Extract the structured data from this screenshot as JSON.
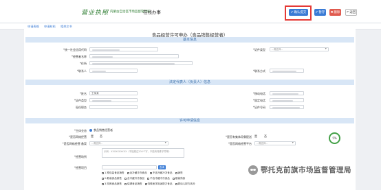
{
  "header": {
    "logo_calligraphy": "营业执照",
    "logo_sub": "内蒙古自治区市场监督管理局",
    "title": "在线办事",
    "buttons": {
      "confirm": "确认提交",
      "save": "暂存",
      "delete": "删除",
      "back": "返回"
    }
  },
  "tabs": [
    "申请表格",
    "申请材料",
    "相关文书"
  ],
  "form": {
    "title": "食品经营许可申办（食品销售经营者）",
    "sections": {
      "basic": "基本信息",
      "legal": "法定代表人（负责人）信息",
      "license": "许可申请信息"
    },
    "basic": {
      "credit_code_label": "*统一社会信用代码",
      "credit_code_value": "",
      "operator_name_label": "*经营者名称",
      "operator_name_value": "",
      "residence_label": "*住所",
      "residence_value": "",
      "certificate_label": "*证件类型",
      "certificate_value": "--请选择--",
      "contact_label": "*联系人",
      "contact_value": "",
      "contact_phone_label": "*联系方式",
      "contact_phone_value": ""
    },
    "legal": {
      "name_label": "*姓名",
      "name_value": "王某某",
      "id_type_label": "*证件类型",
      "id_type_value": "",
      "position_label": "现任职务",
      "position_value": "",
      "phone_label": "*移动电话",
      "phone_value": "",
      "mobile_label": "*固定电话",
      "mobile_value": "",
      "id_no_label": "*证件号码",
      "id_no_value": ""
    },
    "license": {
      "entity_label": "*主体业态",
      "entity_option": "食品销售经营者",
      "chain_label": "*是否网络经营",
      "chain_options": [
        "是",
        "否"
      ],
      "mgmt_label": "*是否有集体用餐配送",
      "mgmt_options": [
        "是",
        "否"
      ],
      "store_label": "*是否网络经营 备案",
      "store_value": "--请选择--",
      "other_label": "*是否网络经营平台",
      "other_value": "--请选择--",
      "scope_label": "*经营项目",
      "scope_placeholder": "示例：XXXXXXXXXX（不能超过200个字，不能有特殊字符等）",
      "remark_label": "*经营场所",
      "project_label": "*经营项目",
      "query_label": "查询",
      "checkbox_rows": [
        [
          "1.预包装食品销售",
          "含冷藏冷冻食品",
          "不含冷藏冷冻食品",
          "销售"
        ],
        [
          "2.散装食品销售",
          "含冷藏冷冻食品",
          "不含冷藏冷冻食品",
          "散装熟食"
        ],
        [
          "3.特殊食品销售",
          "保健食品销售",
          "特殊医学用途配方食品",
          "婴幼儿配方乳粉",
          "其他婴幼儿配方食品"
        ]
      ]
    }
  },
  "gauge_text": "5%",
  "watermark": "鄂托克前旗市场监督管理局"
}
